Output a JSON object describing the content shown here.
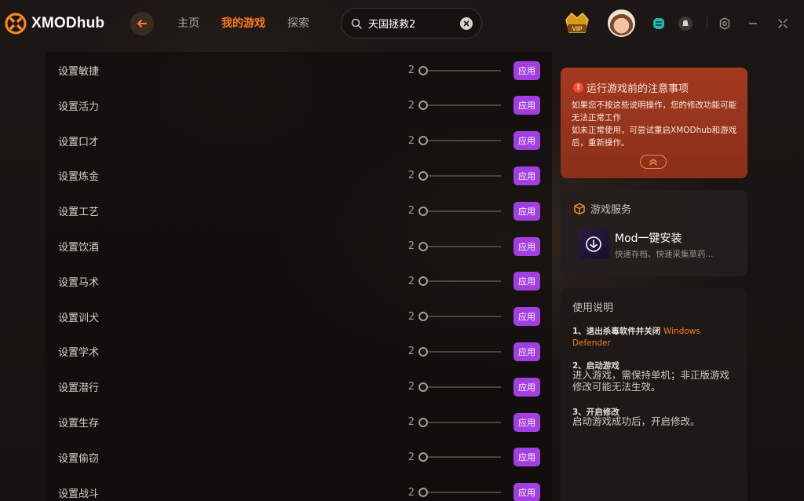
{
  "app": {
    "name": "XMODhub"
  },
  "nav": {
    "home": "主页",
    "my_games": "我的游戏",
    "explore": "探索"
  },
  "search": {
    "value": "天国拯救2"
  },
  "vip": {
    "label": "VIP"
  },
  "colors": {
    "accent": "#ff7a1a",
    "apply": "#a23fe0",
    "notice_bg": "#a33a20"
  },
  "settings": [
    {
      "label": "设置敏捷",
      "value": "2",
      "action": "应用"
    },
    {
      "label": "设置活力",
      "value": "2",
      "action": "应用"
    },
    {
      "label": "设置口才",
      "value": "2",
      "action": "应用"
    },
    {
      "label": "设置炼金",
      "value": "2",
      "action": "应用"
    },
    {
      "label": "设置工艺",
      "value": "2",
      "action": "应用"
    },
    {
      "label": "设置饮酒",
      "value": "2",
      "action": "应用"
    },
    {
      "label": "设置马术",
      "value": "2",
      "action": "应用"
    },
    {
      "label": "设置训犬",
      "value": "2",
      "action": "应用"
    },
    {
      "label": "设置学术",
      "value": "2",
      "action": "应用"
    },
    {
      "label": "设置潜行",
      "value": "2",
      "action": "应用"
    },
    {
      "label": "设置生存",
      "value": "2",
      "action": "应用"
    },
    {
      "label": "设置偷窃",
      "value": "2",
      "action": "应用"
    },
    {
      "label": "设置战斗",
      "value": "2",
      "action": "应用"
    }
  ],
  "notice": {
    "title": "运行游戏前的注意事项",
    "line1": "如果您不按这些说明操作，您的修改功能可能无法正常工作",
    "line2": "如未正常使用，可尝试重启XMODhub和游戏后，重新操作。"
  },
  "service": {
    "title": "游戏服务",
    "mod_title": "Mod一键安装",
    "mod_sub": "快速存档、快速采集草药..."
  },
  "usage": {
    "title": "使用说明",
    "step1_title": "1、退出杀毒软件并关闭",
    "step1_highlight": "Windows Defender",
    "step2_title": "2、启动游戏",
    "step2_text": "进入游戏，需保持单机；非正版游戏修改可能无法生效。",
    "step3_title": "3、开启修改",
    "step3_text": "启动游戏成功后，开启修改。"
  }
}
